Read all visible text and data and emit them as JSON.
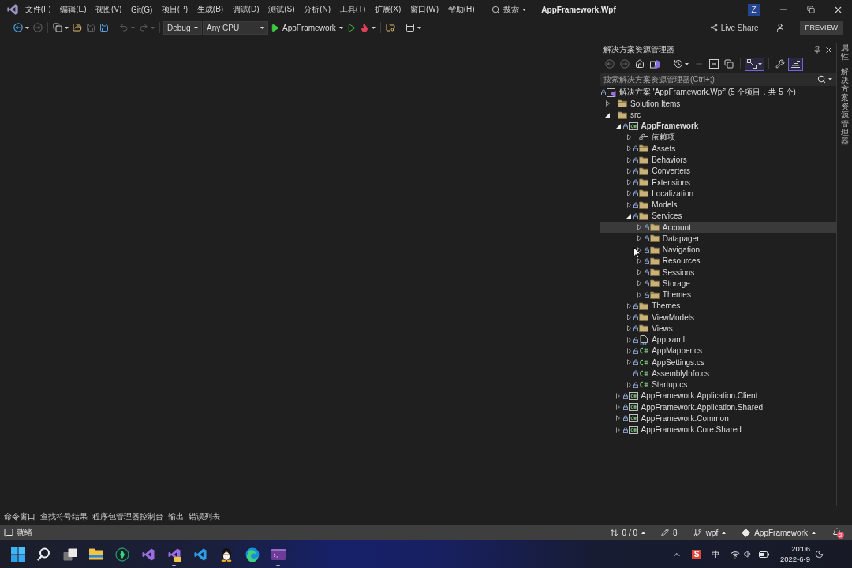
{
  "title_bar": {
    "menu": [
      "文件(F)",
      "编辑(E)",
      "视图(V)",
      "Git(G)",
      "项目(P)",
      "生成(B)",
      "调试(D)",
      "测试(S)",
      "分析(N)",
      "工具(T)",
      "扩展(X)",
      "窗口(W)",
      "帮助(H)"
    ],
    "search": "搜索",
    "title": "AppFramework.Wpf",
    "account": "Z"
  },
  "toolbar": {
    "items": [
      {
        "kind": "back",
        "disabled": false
      },
      {
        "kind": "forward",
        "disabled": true
      },
      {
        "kind": "new-item",
        "disabled": false
      },
      {
        "kind": "open",
        "disabled": false
      },
      {
        "kind": "save",
        "disabled": true
      },
      {
        "kind": "save-all",
        "disabled": false
      },
      {
        "kind": "undo",
        "disabled": true
      },
      {
        "kind": "redo",
        "disabled": true
      },
      {
        "kind": "configuration",
        "value": "Debug",
        "disabled": false
      },
      {
        "kind": "platform",
        "value": "Any CPU",
        "disabled": false
      },
      {
        "kind": "run",
        "label": "AppFramework",
        "disabled": false
      },
      {
        "kind": "run-plain",
        "disabled": false
      },
      {
        "kind": "hot-reload",
        "disabled": false
      },
      {
        "kind": "folder-search",
        "disabled": false
      },
      {
        "kind": "layout",
        "disabled": false
      }
    ],
    "live_share": "Live Share",
    "preview": "PREVIEW"
  },
  "solution_explorer": {
    "title": "解决方案资源管理器",
    "tools": [
      {
        "kind": "back",
        "disabled": true,
        "selected": false
      },
      {
        "kind": "forward",
        "disabled": true,
        "selected": false
      },
      {
        "kind": "home",
        "disabled": false,
        "selected": false
      },
      {
        "kind": "switch-views",
        "disabled": false,
        "selected": false
      },
      {
        "kind": "history",
        "disabled": false,
        "selected": false
      },
      {
        "kind": "pending",
        "disabled": true,
        "selected": false
      },
      {
        "kind": "collapse-all",
        "disabled": false,
        "selected": false
      },
      {
        "kind": "show-all",
        "disabled": false,
        "selected": false
      },
      {
        "kind": "sync",
        "disabled": false,
        "selected": true
      },
      {
        "kind": "properties",
        "disabled": false,
        "selected": false
      },
      {
        "kind": "preview",
        "disabled": false,
        "selected": true
      }
    ],
    "search": {
      "placeholder": "搜索解决方案资源管理器(Ctrl+;)"
    },
    "tree": {
      "kind": "solution",
      "label": "解决方案 'AppFramework.Wpf' (5 个项目，共 5 个)",
      "expandable": false,
      "locked": true,
      "selected": false,
      "children": [
        {
          "kind": "folder",
          "label": "Solution Items",
          "expandable": true,
          "expanded": false,
          "locked": false,
          "selected": false
        },
        {
          "kind": "folder",
          "label": "src",
          "expandable": true,
          "expanded": true,
          "locked": false,
          "selected": false,
          "children": [
            {
              "kind": "project",
              "label": "AppFramework",
              "expandable": true,
              "expanded": true,
              "locked": true,
              "selected": false,
              "startup": true,
              "children": [
                {
                  "kind": "dependencies",
                  "label": "依赖项",
                  "expandable": true,
                  "expanded": false,
                  "locked": false,
                  "selected": false
                },
                {
                  "kind": "folder",
                  "label": "Assets",
                  "expandable": true,
                  "expanded": false,
                  "locked": true,
                  "selected": false
                },
                {
                  "kind": "folder",
                  "label": "Behaviors",
                  "expandable": true,
                  "expanded": false,
                  "locked": true,
                  "selected": false
                },
                {
                  "kind": "folder",
                  "label": "Converters",
                  "expandable": true,
                  "expanded": false,
                  "locked": true,
                  "selected": false
                },
                {
                  "kind": "folder",
                  "label": "Extensions",
                  "expandable": true,
                  "expanded": false,
                  "locked": true,
                  "selected": false
                },
                {
                  "kind": "folder",
                  "label": "Localization",
                  "expandable": true,
                  "expanded": false,
                  "locked": true,
                  "selected": false
                },
                {
                  "kind": "folder",
                  "label": "Models",
                  "expandable": true,
                  "expanded": false,
                  "locked": true,
                  "selected": false
                },
                {
                  "kind": "folder",
                  "label": "Services",
                  "expandable": true,
                  "expanded": true,
                  "locked": true,
                  "selected": false,
                  "children": [
                    {
                      "kind": "folder",
                      "label": "Account",
                      "expandable": true,
                      "expanded": false,
                      "locked": true,
                      "selected": true
                    },
                    {
                      "kind": "folder",
                      "label": "Datapager",
                      "expandable": true,
                      "expanded": false,
                      "locked": true,
                      "selected": false
                    },
                    {
                      "kind": "folder",
                      "label": "Navigation",
                      "expandable": true,
                      "expanded": false,
                      "locked": true,
                      "selected": false
                    },
                    {
                      "kind": "folder",
                      "label": "Resources",
                      "expandable": true,
                      "expanded": false,
                      "locked": true,
                      "selected": false
                    },
                    {
                      "kind": "folder",
                      "label": "Sessions",
                      "expandable": true,
                      "expanded": false,
                      "locked": true,
                      "selected": false
                    },
                    {
                      "kind": "folder",
                      "label": "Storage",
                      "expandable": true,
                      "expanded": false,
                      "locked": true,
                      "selected": false
                    },
                    {
                      "kind": "folder",
                      "label": "Themes",
                      "expandable": true,
                      "expanded": false,
                      "locked": true,
                      "selected": false
                    }
                  ]
                },
                {
                  "kind": "folder",
                  "label": "Themes",
                  "expandable": true,
                  "expanded": false,
                  "locked": true,
                  "selected": false
                },
                {
                  "kind": "folder",
                  "label": "ViewModels",
                  "expandable": true,
                  "expanded": false,
                  "locked": true,
                  "selected": false
                },
                {
                  "kind": "folder",
                  "label": "Views",
                  "expandable": true,
                  "expanded": false,
                  "locked": true,
                  "selected": false
                },
                {
                  "kind": "xaml",
                  "label": "App.xaml",
                  "expandable": true,
                  "expanded": false,
                  "locked": true,
                  "selected": false
                },
                {
                  "kind": "csharp",
                  "label": "AppMapper.cs",
                  "expandable": true,
                  "expanded": false,
                  "locked": true,
                  "selected": false
                },
                {
                  "kind": "csharp",
                  "label": "AppSettings.cs",
                  "expandable": true,
                  "expanded": false,
                  "locked": true,
                  "selected": false
                },
                {
                  "kind": "csharp",
                  "label": "AssemblyInfo.cs",
                  "expandable": false,
                  "locked": true,
                  "selected": false
                },
                {
                  "kind": "csharp",
                  "label": "Startup.cs",
                  "expandable": true,
                  "expanded": false,
                  "locked": true,
                  "selected": false
                }
              ]
            },
            {
              "kind": "project",
              "label": "AppFramework.Application.Client",
              "expandable": true,
              "expanded": false,
              "locked": true,
              "selected": false,
              "startup": false
            },
            {
              "kind": "project",
              "label": "AppFramework.Application.Shared",
              "expandable": true,
              "expanded": false,
              "locked": true,
              "selected": false,
              "startup": false
            },
            {
              "kind": "project",
              "label": "AppFramework.Common",
              "expandable": true,
              "expanded": false,
              "locked": true,
              "selected": false,
              "startup": false
            },
            {
              "kind": "project",
              "label": "AppFramework.Core.Shared",
              "expandable": true,
              "expanded": false,
              "locked": true,
              "selected": false,
              "startup": false
            }
          ]
        }
      ]
    }
  },
  "side_tabs": [
    "属性",
    "解决方案资源管理器"
  ],
  "tool_tabs": [
    "命令窗口",
    "查找符号结果",
    "程序包管理器控制台",
    "输出",
    "错误列表"
  ],
  "status_bar": {
    "message": "就绪",
    "items": [
      {
        "kind": "sync",
        "text": "0 / 0",
        "menu": true
      },
      {
        "kind": "edits",
        "text": "8",
        "menu": false
      },
      {
        "kind": "branch",
        "text": "wpf",
        "menu": true
      },
      {
        "kind": "repository",
        "text": "AppFramework",
        "menu": true
      }
    ],
    "notifications": "2"
  },
  "taskbar": {
    "apps": [
      {
        "kind": "start",
        "running": false
      },
      {
        "kind": "search",
        "running": false
      },
      {
        "kind": "task-view",
        "running": false
      },
      {
        "kind": "files",
        "running": false
      },
      {
        "kind": "app",
        "running": false
      },
      {
        "kind": "ide",
        "running": false
      },
      {
        "kind": "ide-preview",
        "running": true
      },
      {
        "kind": "editor",
        "running": false
      },
      {
        "kind": "chat",
        "running": false
      },
      {
        "kind": "browser",
        "running": false
      },
      {
        "kind": "terminal",
        "running": true
      }
    ],
    "tray": {
      "ime_badge": "S",
      "ime_mode": "中",
      "time": "20:06",
      "date": "2022-6-9"
    }
  }
}
